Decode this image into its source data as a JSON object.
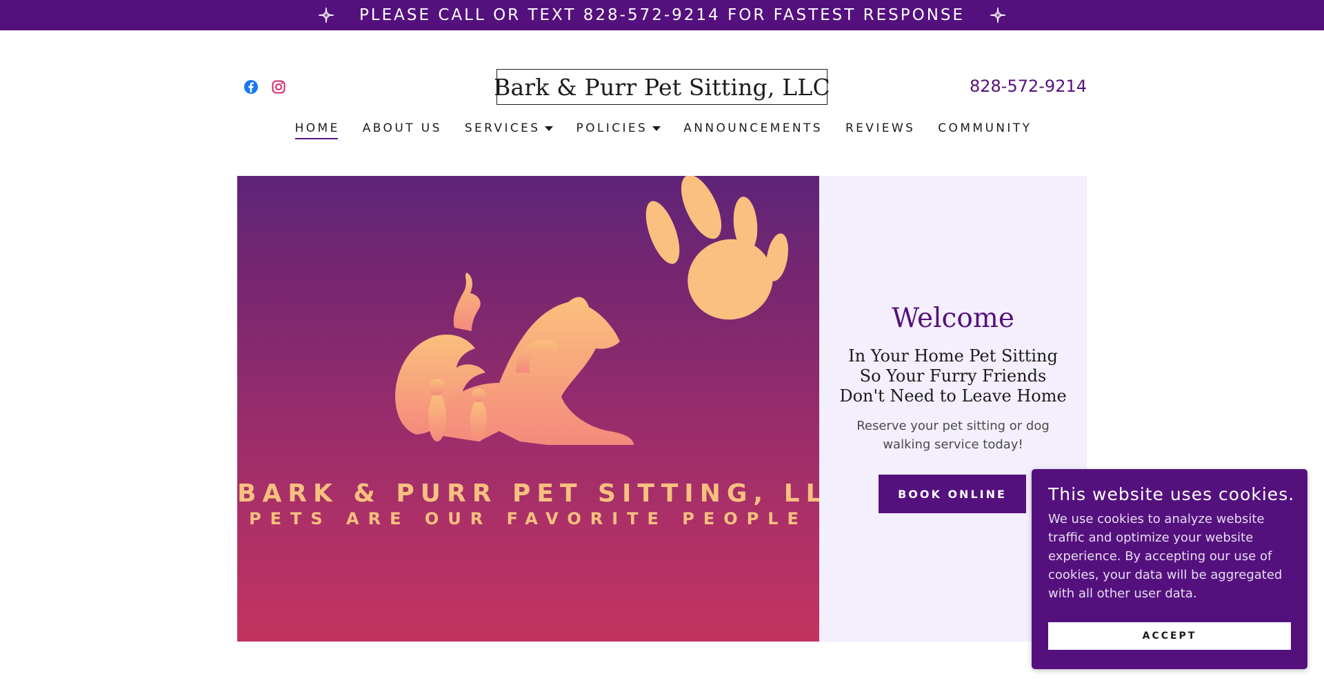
{
  "announcement": {
    "text": "PLEASE CALL OR TEXT 828-572-9214 FOR FASTEST RESPONSE"
  },
  "header": {
    "social": [
      {
        "name": "facebook-icon",
        "color": "#1877f2"
      },
      {
        "name": "instagram-icon",
        "color": "#d6246e"
      }
    ],
    "logo_text": "Bark & Purr Pet Sitting, LLC",
    "phone": "828-572-9214"
  },
  "nav": {
    "items": [
      {
        "label": "HOME",
        "active": true,
        "dropdown": false
      },
      {
        "label": "ABOUT US",
        "active": false,
        "dropdown": false
      },
      {
        "label": "SERVICES",
        "active": false,
        "dropdown": true
      },
      {
        "label": "POLICIES",
        "active": false,
        "dropdown": true
      },
      {
        "label": "ANNOUNCEMENTS",
        "active": false,
        "dropdown": false
      },
      {
        "label": "REVIEWS",
        "active": false,
        "dropdown": false
      },
      {
        "label": "COMMUNITY",
        "active": false,
        "dropdown": false
      }
    ]
  },
  "hero": {
    "image_title": "BARK & PURR PET SITTING, LLC",
    "image_subtitle": "PETS ARE OUR FAVORITE PEOPLE",
    "welcome": "Welcome",
    "tagline_lines": [
      "In Your Home Pet Sitting",
      "So Your Furry Friends",
      "Don't Need to Leave Home"
    ],
    "reserve_text": "Reserve your pet sitting or dog walking service today!",
    "book_button": "BOOK ONLINE"
  },
  "cookie": {
    "title": "This website uses cookies.",
    "body": "We use cookies to analyze website traffic and optimize your website experience. By accepting our use of cookies, your data will be aggregated with all other user data.",
    "accept_button": "ACCEPT"
  },
  "colors": {
    "brand": "#54117e",
    "panel": "#f4effd",
    "logo_art": "#f9c07f"
  }
}
